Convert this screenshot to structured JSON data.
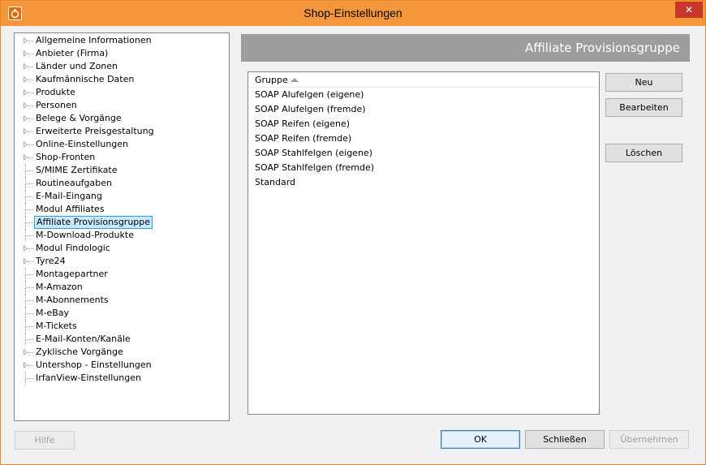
{
  "window": {
    "title": "Shop-Einstellungen",
    "close_symbol": "✕"
  },
  "tree": {
    "items": [
      {
        "label": "Allgemeine Informationen",
        "expandable": true
      },
      {
        "label": "Anbieter (Firma)",
        "expandable": true
      },
      {
        "label": "Länder und Zonen",
        "expandable": true
      },
      {
        "label": "Kaufmännische Daten",
        "expandable": true
      },
      {
        "label": "Produkte",
        "expandable": true
      },
      {
        "label": "Personen",
        "expandable": true
      },
      {
        "label": "Belege & Vorgänge",
        "expandable": true
      },
      {
        "label": "Erweiterte Preisgestaltung",
        "expandable": true
      },
      {
        "label": "Online-Einstellungen",
        "expandable": true
      },
      {
        "label": "Shop-Fronten",
        "expandable": true
      },
      {
        "label": "S/MIME Zertifikate",
        "expandable": false
      },
      {
        "label": "Routineaufgaben",
        "expandable": false
      },
      {
        "label": "E-Mail-Eingang",
        "expandable": false
      },
      {
        "label": "Modul Affiliates",
        "expandable": false
      },
      {
        "label": "Affiliate Provisionsgruppe",
        "expandable": false,
        "selected": true
      },
      {
        "label": "M-Download-Produkte",
        "expandable": false
      },
      {
        "label": "Modul Findologic",
        "expandable": true
      },
      {
        "label": "Tyre24",
        "expandable": true
      },
      {
        "label": "Montagepartner",
        "expandable": false
      },
      {
        "label": "M-Amazon",
        "expandable": false
      },
      {
        "label": "M-Abonnements",
        "expandable": false
      },
      {
        "label": "M-eBay",
        "expandable": false
      },
      {
        "label": "M-Tickets",
        "expandable": false
      },
      {
        "label": "E-Mail-Konten/Kanäle",
        "expandable": false
      },
      {
        "label": "Zyklische Vorgänge",
        "expandable": true
      },
      {
        "label": "Untershop - Einstellungen",
        "expandable": true
      },
      {
        "label": "IrfanView-Einstellungen",
        "expandable": false
      }
    ]
  },
  "panel": {
    "title": "Affiliate Provisionsgruppe"
  },
  "list": {
    "column_header": "Gruppe",
    "rows": [
      "SOAP Alufelgen (eigene)",
      "SOAP Alufelgen (fremde)",
      "SOAP Reifen (eigene)",
      "SOAP Reifen (fremde)",
      "SOAP Stahlfelgen (eigene)",
      "SOAP Stahlfelgen (fremde)",
      "Standard"
    ]
  },
  "side_buttons": {
    "new": "Neu",
    "edit": "Bearbeiten",
    "delete": "Löschen"
  },
  "footer_buttons": {
    "help": "Hilfe",
    "ok": "OK",
    "close": "Schließen",
    "apply": "Übernehmen"
  },
  "colors": {
    "titlebar": "#f4973c",
    "banner": "#9d9d9d",
    "close_button": "#c7372c",
    "selection": "#cce8ff"
  }
}
